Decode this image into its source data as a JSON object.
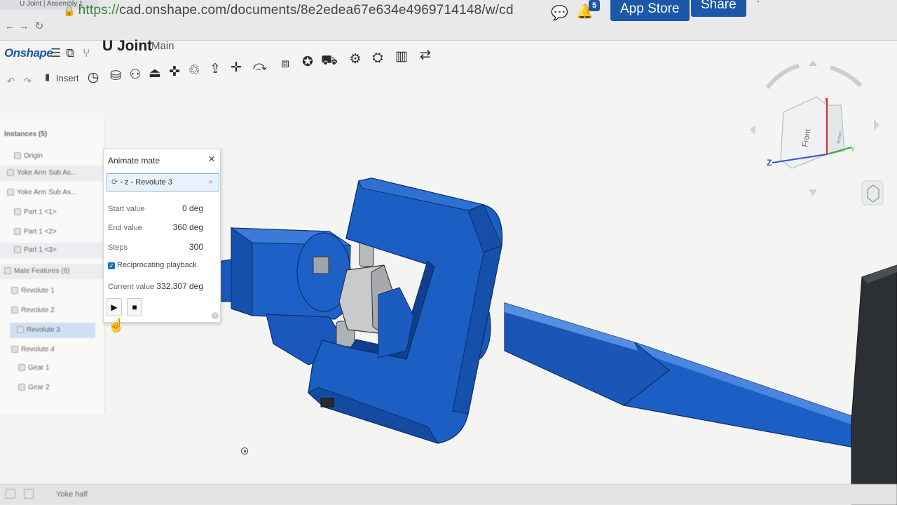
{
  "browser": {
    "tab_title": "U Joint | Assembly 1",
    "url_secure": "https://",
    "url_rest": "cad.onshape.com/documents/8e2edea67e634e4969714148/w/cd"
  },
  "header": {
    "logo": "Onshape",
    "doc_title": "U Joint",
    "branch": "Main",
    "app_store_label": "App Store",
    "share_label": "Share",
    "notification_count": "5"
  },
  "toolbar": {
    "insert_label": "Insert",
    "icons": [
      "history-icon",
      "mate-connector-icon",
      "fastened-mate-icon",
      "revolute-mate-icon",
      "slider-mate-icon",
      "planar-mate-icon",
      "cylindrical-mate-icon",
      "pin-slot-mate-icon",
      "ball-mate-icon",
      "group-icon",
      "mate-relation-icon",
      "replicate-icon",
      "explode-icon",
      "gear-relation-icon",
      "rack-pinion-icon",
      "screw-relation-icon",
      "linear-relation-icon"
    ]
  },
  "feature_list": {
    "header": "Instances (5)",
    "items": [
      {
        "label": "Origin"
      },
      {
        "label": "Yoke Arm Sub As..."
      },
      {
        "label": "Yoke Arm Sub As..."
      },
      {
        "label": "Part 1 <1>"
      },
      {
        "label": "Part 1 <2>"
      },
      {
        "label": "Part 1 <3>"
      },
      {
        "label": "Mate Features (6)"
      },
      {
        "label": "Revolute 1"
      },
      {
        "label": "Revolute 2"
      },
      {
        "label": "Revolute 3"
      },
      {
        "label": "Revolute 4"
      },
      {
        "label": "Gear 1"
      },
      {
        "label": "Gear 2"
      }
    ]
  },
  "animate_dialog": {
    "title": "Animate mate",
    "close": "×",
    "mate": "- z - Revolute 3",
    "start_label": "Start value",
    "start_value": "0 deg",
    "end_label": "End value",
    "end_value": "360 deg",
    "steps_label": "Steps",
    "steps_value": "300",
    "reciprocating_label": "Reciprocating playback",
    "reciprocating_checked": true,
    "current_label": "Current value",
    "current_value": "332.307 deg",
    "play": "▶",
    "stop": "■",
    "help": "?"
  },
  "view_cube": {
    "front_label": "Front",
    "side_label": "Bottom",
    "axis_x": "X",
    "axis_y": "Y",
    "axis_z": "Z"
  },
  "bottom_bar": {
    "tab_label": "Yoke half"
  },
  "colors": {
    "part_blue": "#1c5fc4",
    "part_blue_dark": "#0f3f8e",
    "brand_blue": "#1b58a7",
    "cross_gray": "#c9cbcd"
  }
}
